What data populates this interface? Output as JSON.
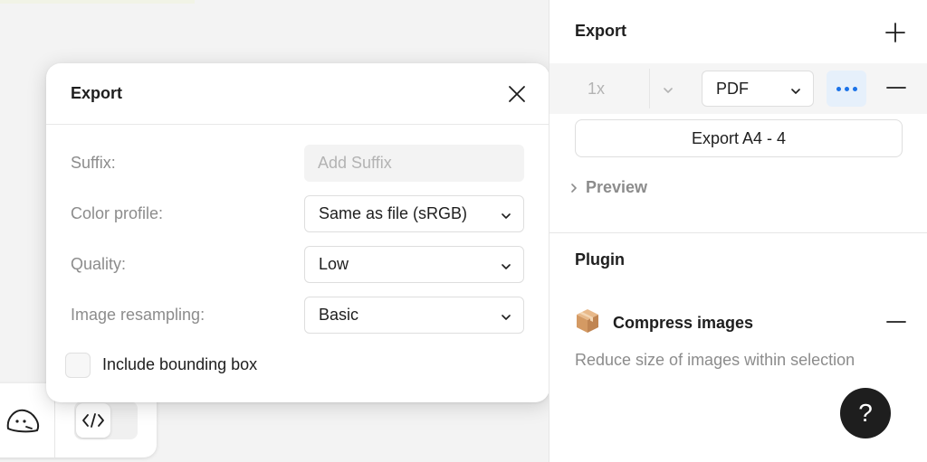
{
  "dialog": {
    "title": "Export",
    "suffix_label": "Suffix:",
    "suffix_placeholder": "Add Suffix",
    "suffix_value": "",
    "color_profile_label": "Color profile:",
    "color_profile_value": "Same as file (sRGB)",
    "quality_label": "Quality:",
    "quality_value": "Low",
    "resampling_label": "Image resampling:",
    "resampling_value": "Basic",
    "bounding_box_label": "Include bounding box",
    "bounding_box_checked": false
  },
  "panel": {
    "export_title": "Export",
    "scale_value": "1x",
    "format_value": "PDF",
    "export_button_label": "Export A4 - 4",
    "preview_label": "Preview",
    "plugin_title": "Plugin",
    "plugin_name": "Compress images",
    "plugin_description": "Reduce size of images within selection",
    "help_label": "?"
  },
  "colors": {
    "accent": "#1b73e8",
    "accent_bg": "#e6f0fb",
    "help_bg": "#1e1e1e"
  },
  "icons": {
    "close": "close-icon",
    "add": "plus-icon",
    "more": "more-horizontal-icon",
    "remove": "minus-icon",
    "chevron": "chevron-down-icon",
    "preview_chevron": "chevron-right-icon",
    "plugin": "package-box-icon",
    "face": "face-sketch-icon",
    "code": "code-icon"
  }
}
